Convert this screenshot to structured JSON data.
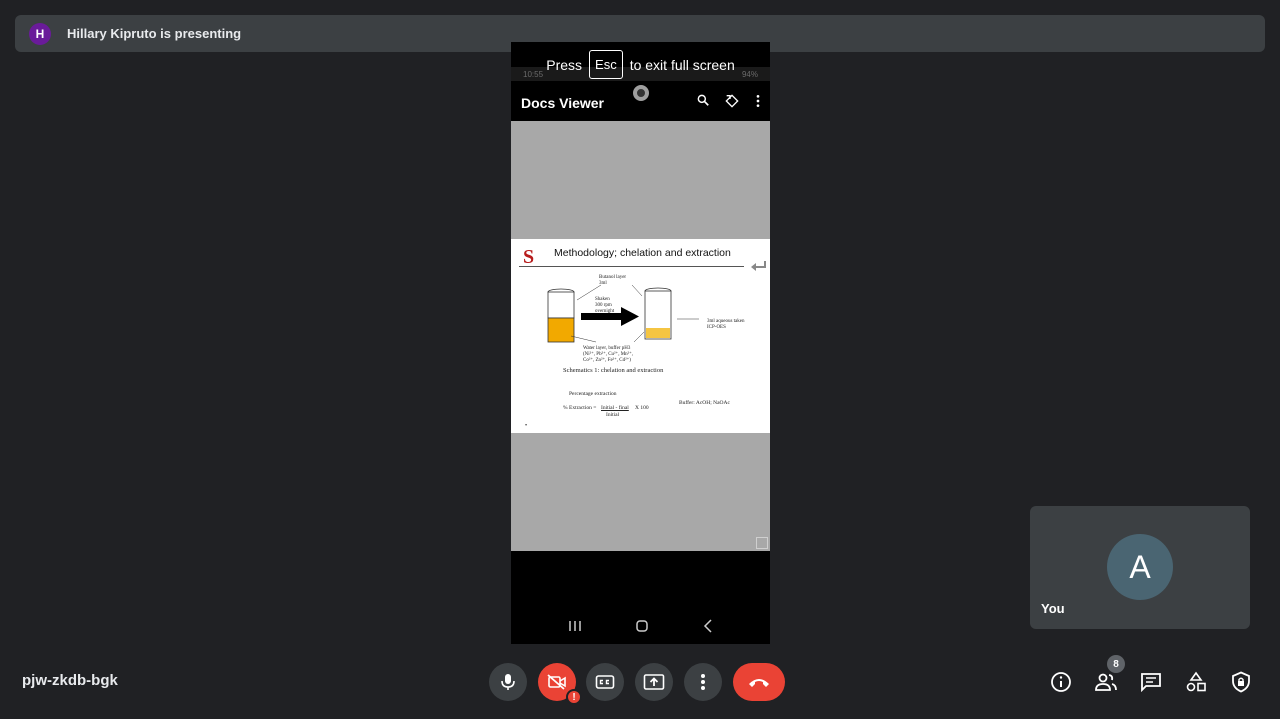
{
  "presenter": {
    "initial": "H",
    "text": "Hillary Kipruto is presenting"
  },
  "fullscreen_toast": {
    "press": "Press",
    "key": "Esc",
    "suffix": "to exit full screen"
  },
  "phone": {
    "status_time": "10:55",
    "status_battery": "94%",
    "app_title": "Docs Viewer",
    "app_icons": [
      "search-icon",
      "rotate-icon",
      "more-vert-icon"
    ],
    "nav_icons": [
      "recents-icon",
      "home-icon",
      "back-icon"
    ]
  },
  "slide": {
    "logo": "S",
    "title": "Methodology; chelation and extraction",
    "organic_label": "Butanol layer\n3ml",
    "shaken_label": "Shaken\n300 rpm\novernight",
    "water_label": "Water layer, buffer pH3\n(Ni²⁺, Pb²⁺, Cu²⁺, Mn²⁺,\nCo²⁺, Zn²⁺, Fe²⁺, Cd²⁺)",
    "icp_label": "3ml aqueous taken\nICP-OES",
    "schematic_caption": "Schematics 1: chelation and extraction",
    "percentage_heading": "Percentage extraction",
    "formula_prefix": "% Extraction =",
    "formula_numerator": "Initial - final",
    "formula_multiplier": "X 100",
    "formula_denominator": "Initial",
    "buffer_label": "Buffer: AcOH; NaOAc",
    "bullet": "•"
  },
  "self_tile": {
    "initial": "A",
    "label": "You"
  },
  "meeting_code": "pjw-zkdb-bgk",
  "people_count": "8",
  "alert_mark": "!",
  "colors": {
    "background": "#202124",
    "surface": "#3c4043",
    "danger": "#ea4335",
    "avatar_presenter": "#6a1b9a",
    "avatar_self": "#4a6572"
  }
}
